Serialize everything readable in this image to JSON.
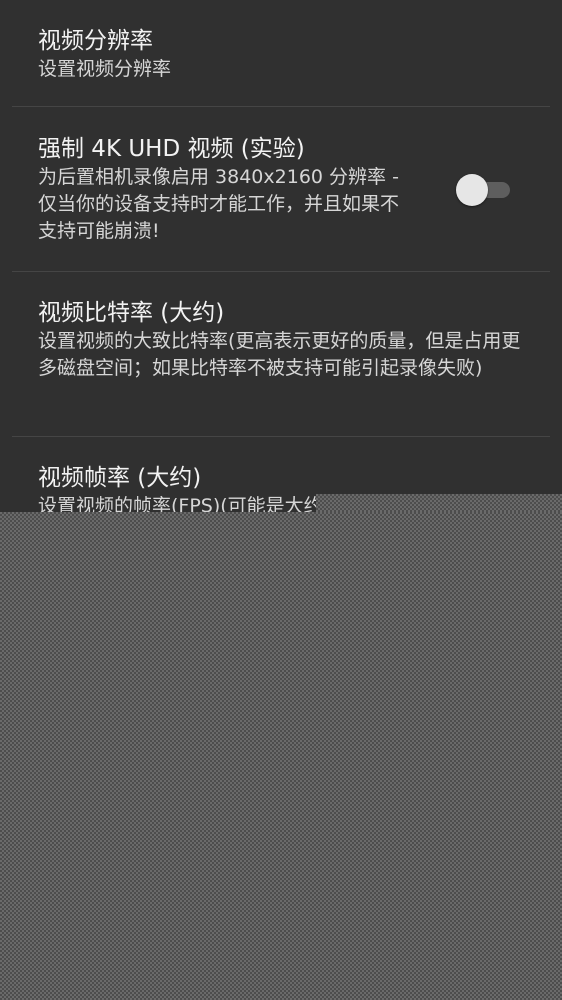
{
  "preferences": [
    {
      "title": "视频分辨率",
      "summary": "设置视频分辨率"
    },
    {
      "title": "强制 4K UHD 视频 (实验)",
      "summary": "为后置相机录像启用 3840x2160 分辨率 - 仅当你的设备支持时才能工作，并且如果不支持可能崩溃!",
      "toggle": {
        "checked": false
      }
    },
    {
      "title": "视频比特率 (大约)",
      "summary": "设置视频的大致比特率(更高表示更好的质量，但是占用更多磁盘空间；如果比特率不被支持可能引起录像失败)"
    },
    {
      "title": "视频帧率 (大约)",
      "summary": "设置视频的帧率(FPS)(可能是大约，不能"
    }
  ],
  "colors": {
    "background": "#303030",
    "divider": "#454545",
    "title": "#f2f2f2",
    "summary": "#d6d6d6",
    "switch_thumb": "#e6e6e6",
    "switch_track": "#5e5e5e"
  }
}
